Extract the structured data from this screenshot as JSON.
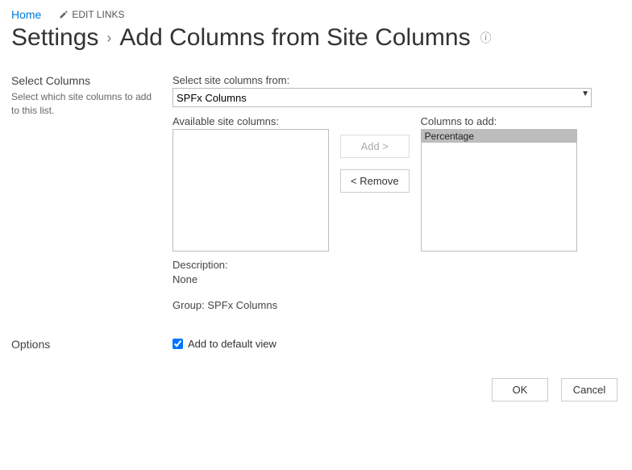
{
  "topnav": {
    "home": "Home",
    "edit_links": "EDIT LINKS"
  },
  "breadcrumb": {
    "settings": "Settings",
    "page": "Add Columns from Site Columns"
  },
  "select_columns": {
    "section_title": "Select Columns",
    "section_desc": "Select which site columns to add to this list.",
    "select_from_label": "Select site columns from:",
    "select_from_value": "SPFx Columns",
    "available_label": "Available site columns:",
    "columns_to_add_label": "Columns to add:",
    "columns_to_add_items": [
      "Percentage"
    ],
    "add_button": "Add >",
    "remove_button": "< Remove",
    "description_label": "Description:",
    "description_value": "None",
    "group_label": "Group:",
    "group_value": "SPFx Columns"
  },
  "options": {
    "section_title": "Options",
    "default_view_label": "Add to default view",
    "default_view_checked": true
  },
  "footer": {
    "ok": "OK",
    "cancel": "Cancel"
  }
}
